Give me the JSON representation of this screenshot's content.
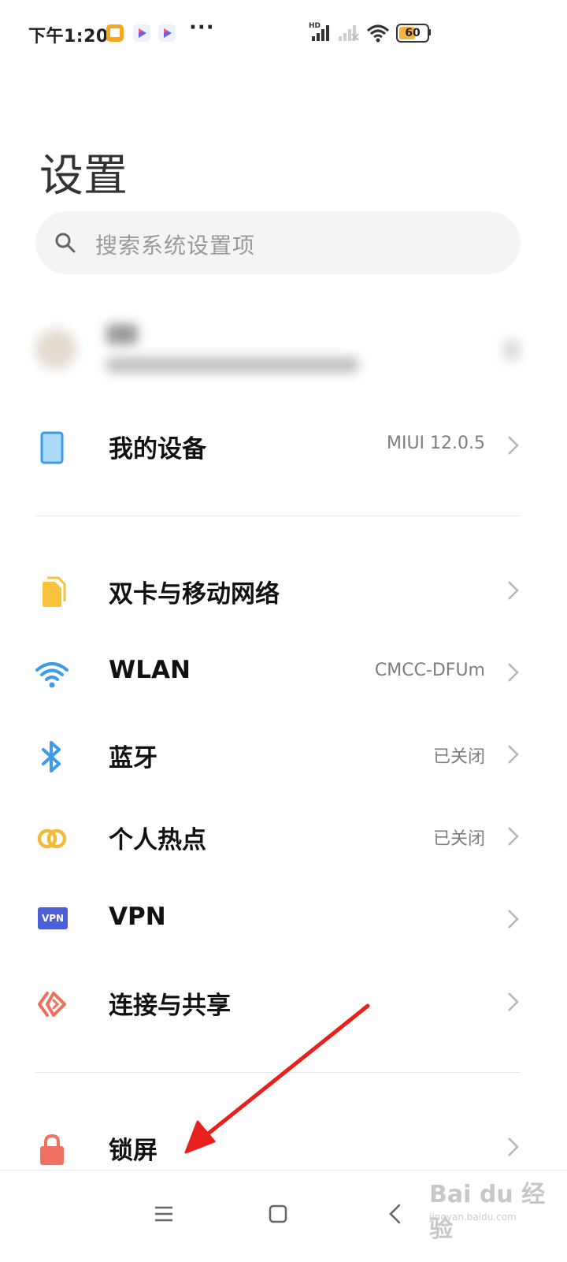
{
  "status_bar": {
    "time": "下午1:20",
    "network_label": "HD",
    "battery_level": "60",
    "more": "···"
  },
  "page": {
    "title": "设置"
  },
  "search": {
    "placeholder": "搜索系统设置项"
  },
  "rows": [
    {
      "label": "我的设备",
      "value": "MIUI 12.0.5",
      "icon": "device-icon"
    },
    {
      "label": "双卡与移动网络",
      "value": "",
      "icon": "sim-card-icon"
    },
    {
      "label": "WLAN",
      "value": "CMCC-DFUm",
      "icon": "wifi-icon"
    },
    {
      "label": "蓝牙",
      "value": "已关闭",
      "icon": "bluetooth-icon"
    },
    {
      "label": "个人热点",
      "value": "已关闭",
      "icon": "hotspot-icon"
    },
    {
      "label": "VPN",
      "value": "",
      "icon": "vpn-icon"
    },
    {
      "label": "连接与共享",
      "value": "",
      "icon": "share-icon"
    },
    {
      "label": "锁屏",
      "value": "",
      "icon": "lock-icon"
    }
  ],
  "icons": {
    "vpn_badge_text": "VPN"
  },
  "watermark": {
    "brand": "Bai du 经验",
    "url": "jingyan.baidu.com"
  },
  "colors": {
    "accent_blue": "#3d9be9",
    "sim_yellow": "#f8c23c",
    "hotspot_yellow": "#f2b93b",
    "vpn_indigo": "#4b5fd9",
    "share_red": "#ef6f5b",
    "lock_red": "#f07062",
    "annotation_arrow": "#e8201e"
  }
}
